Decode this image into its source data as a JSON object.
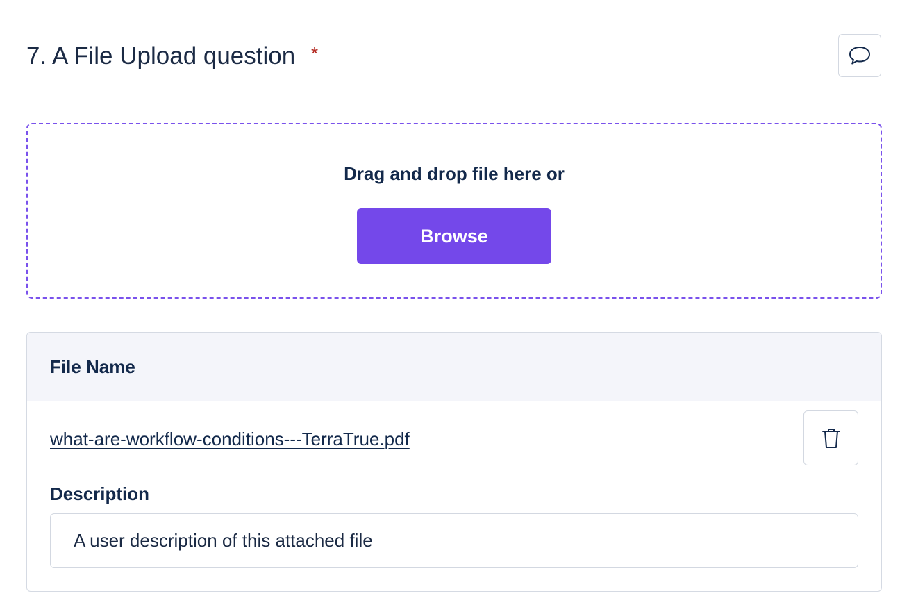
{
  "question": {
    "title": "7. A File Upload question",
    "required_marker": "*",
    "comment_icon": "speech-bubble-icon"
  },
  "dropzone": {
    "prompt": "Drag and drop file here or",
    "browse_label": "Browse"
  },
  "file_table": {
    "header_label": "File Name",
    "files": [
      {
        "name": "what-are-workflow-conditions---TerraTrue.pdf",
        "delete_icon": "trash-icon",
        "description_label": "Description",
        "description_value": "A user description of this attached file"
      }
    ]
  },
  "colors": {
    "accent": "#7448ea",
    "dropzone_border": "#7a52ec",
    "required": "#b3261e",
    "text": "#13294b",
    "header_bg": "#f4f5fa",
    "border": "#d5dae3"
  }
}
